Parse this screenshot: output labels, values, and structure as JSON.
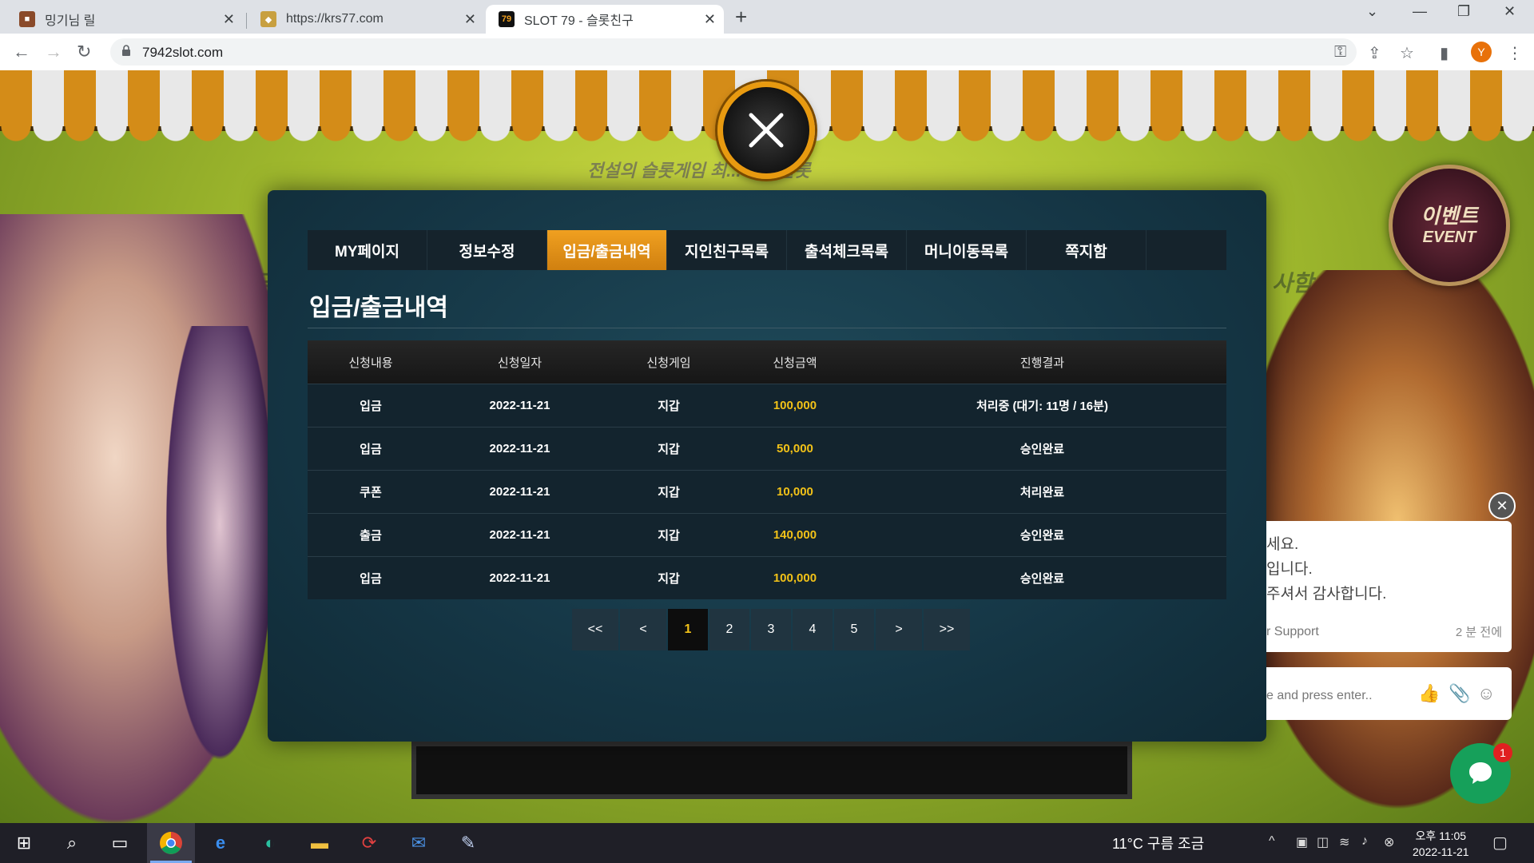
{
  "browser": {
    "tabs": [
      {
        "title": "밍기님 릴",
        "active": false
      },
      {
        "title": "https://krs77.com",
        "active": false
      },
      {
        "title": "SLOT 79 - 슬롯친구",
        "active": true
      }
    ],
    "tab_favicon_label": "79",
    "url": "7942slot.com",
    "profile_initial": "Y"
  },
  "background": {
    "event_badge_ko": "이벤트",
    "event_badge_en": "EVENT",
    "tagline": "전설의 슬롯게임 최... 친구슬롯",
    "left_text": "입금",
    "right_text": "사함"
  },
  "modal": {
    "tabs": [
      {
        "label": "MY페이지",
        "active": false
      },
      {
        "label": "정보수정",
        "active": false
      },
      {
        "label": "입금/출금내역",
        "active": true
      },
      {
        "label": "지인친구목록",
        "active": false
      },
      {
        "label": "출석체크목록",
        "active": false
      },
      {
        "label": "머니이동목록",
        "active": false
      },
      {
        "label": "쪽지함",
        "active": false
      }
    ],
    "section_title": "입금/출금내역",
    "table": {
      "headers": [
        "신청내용",
        "신청일자",
        "신청게임",
        "신청금액",
        "진행결과"
      ],
      "rows": [
        [
          "입금",
          "2022-11-21",
          "지갑",
          "100,000",
          "처리중 (대기: 11명 / 16분)"
        ],
        [
          "입금",
          "2022-11-21",
          "지갑",
          "50,000",
          "승인완료"
        ],
        [
          "쿠폰",
          "2022-11-21",
          "지갑",
          "10,000",
          "처리완료"
        ],
        [
          "출금",
          "2022-11-21",
          "지갑",
          "140,000",
          "승인완료"
        ],
        [
          "입금",
          "2022-11-21",
          "지갑",
          "100,000",
          "승인완료"
        ]
      ]
    },
    "pagination": {
      "first": "<<",
      "prev": "<",
      "pages": [
        "1",
        "2",
        "3",
        "4",
        "5"
      ],
      "current": "1",
      "next": ">",
      "last": ">>"
    }
  },
  "chat": {
    "lines": [
      "세요.",
      "입니다.",
      "주셔서 감사합니다."
    ],
    "source": "r Support",
    "time": "2 분 전에",
    "input_placeholder": "e and press enter..",
    "unread_count": "1"
  },
  "taskbar": {
    "weather": "11°C  구름 조금",
    "clock_time": "오후 11:05",
    "clock_date": "2022-11-21"
  },
  "colors": {
    "accent_orange": "#e89a10",
    "amount_gold": "#f2c218",
    "modal_bg": "#153645",
    "chat_green": "#16a05a"
  }
}
